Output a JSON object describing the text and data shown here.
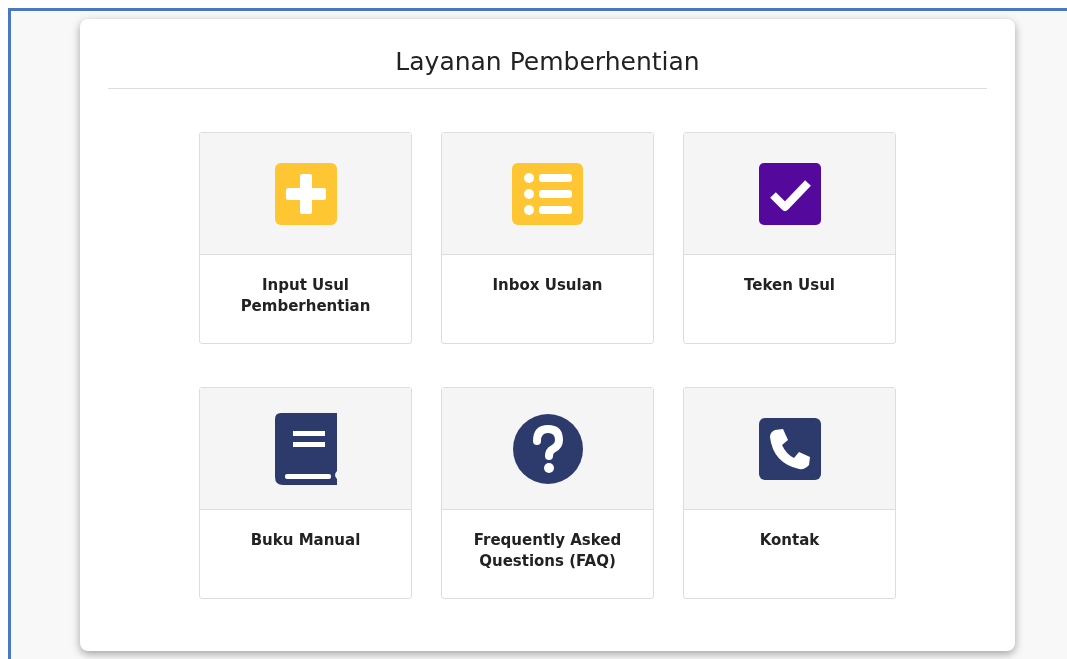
{
  "title": "Layanan Pemberhentian",
  "tiles": [
    {
      "label": "Input Usul Pemberhentian",
      "color": "#ffc633"
    },
    {
      "label": "Inbox Usulan",
      "color": "#ffc633"
    },
    {
      "label": "Teken Usul",
      "color": "#55089c"
    },
    {
      "label": "Buku Manual",
      "color": "#2d3a6c"
    },
    {
      "label": "Frequently Asked Questions (FAQ)",
      "color": "#2d3a6c"
    },
    {
      "label": "Kontak",
      "color": "#2d3a6c"
    }
  ]
}
